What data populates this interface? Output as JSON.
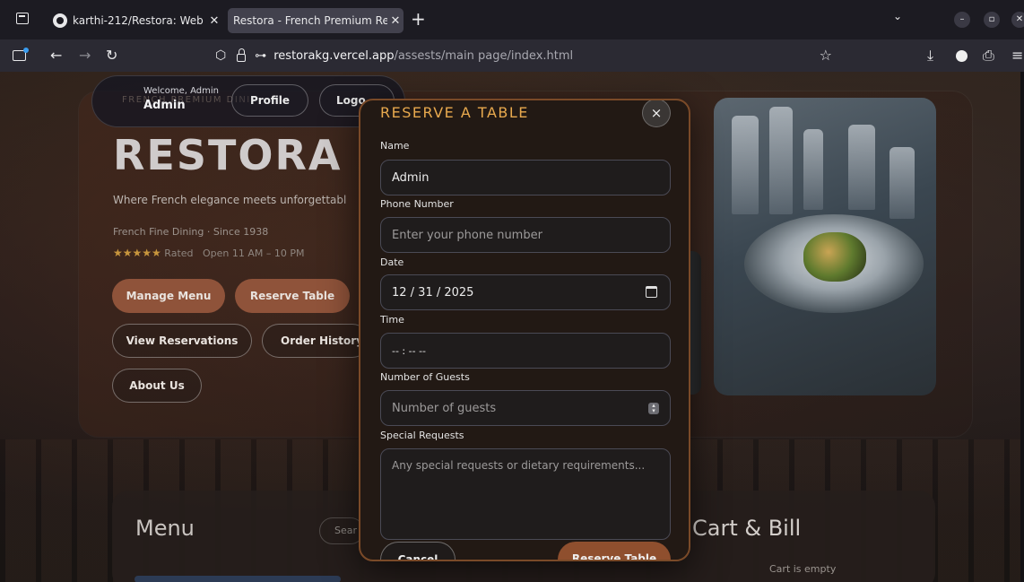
{
  "browser": {
    "tabs": [
      {
        "title": "karthi-212/Restora: Web"
      },
      {
        "title": "Restora - French Premium Re"
      }
    ],
    "url_host": "restorakg.vercel.app",
    "url_path": "/assests/main page/index.html"
  },
  "header": {
    "welcome_small": "Welcome, Admin",
    "welcome_name": "Admin",
    "ghost_text": "FRENCH PREMIUM DINI",
    "profile_label": "Profile",
    "logout_label": "Logo"
  },
  "hero": {
    "title": "RESTORA",
    "tagline": "Where French elegance meets unforgettabl",
    "meta": "French Fine Dining · Since 1938",
    "stars": "★★★★★",
    "rating_text": "Rated",
    "hours": "Open 11 AM – 10 PM",
    "buttons": {
      "manage_menu": "Manage Menu",
      "reserve_table": "Reserve Table",
      "view_reservations": "View Reservations",
      "order_history": "Order History",
      "about_us": "About Us"
    }
  },
  "lower": {
    "menu_title": "Menu",
    "search_ghost": "Sear",
    "cart_title": "Cart & Bill",
    "cart_empty": "Cart is empty"
  },
  "modal": {
    "title": "RESERVE A TABLE",
    "close": "×",
    "fields": {
      "name": {
        "label": "Name",
        "value": "Admin"
      },
      "phone": {
        "label": "Phone Number",
        "placeholder": "Enter your phone number"
      },
      "date": {
        "label": "Date",
        "value": "12 / 31 / 2025"
      },
      "time": {
        "label": "Time",
        "value": "-- : -- --"
      },
      "guests": {
        "label": "Number of Guests",
        "placeholder": "Number of guests"
      },
      "requests": {
        "label": "Special Requests",
        "placeholder": "Any special requests or dietary requirements..."
      }
    },
    "cancel_label": "Cancel",
    "submit_label": "Reserve Table"
  },
  "colors": {
    "accent": "#e8a94e",
    "button_brown": "#8f533a",
    "modal_bg": "#221914"
  }
}
